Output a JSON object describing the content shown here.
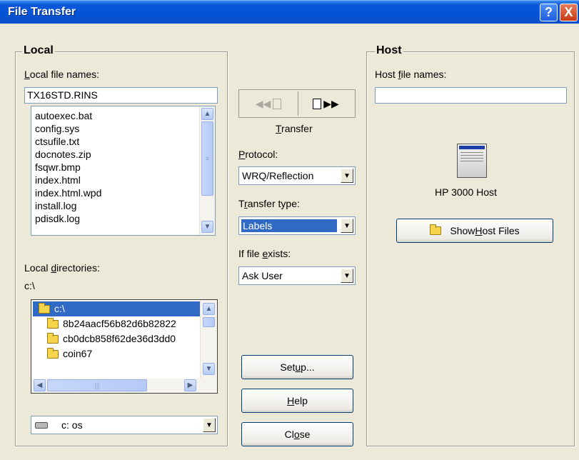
{
  "window": {
    "title": "File Transfer",
    "help_glyph": "?",
    "close_glyph": "X"
  },
  "local": {
    "group_label": "Local",
    "file_names_label_u": "L",
    "file_names_label_rest": "ocal file names:",
    "file_name_value": "TX16STD.RINS",
    "files": [
      "autoexec.bat",
      "config.sys",
      "ctsufile.txt",
      "docnotes.zip",
      "fsqwr.bmp",
      "index.html",
      "index.html.wpd",
      "install.log",
      "pdisdk.log"
    ],
    "dirs_label_pre": "Local ",
    "dirs_label_u": "d",
    "dirs_label_rest": "irectories:",
    "current_dir": "c:\\",
    "dirs": [
      "c:\\",
      "8b24aacf56b82d6b82822",
      "cb0dcb858f62de36d3dd0",
      "coin67"
    ],
    "drive_value": "c:  os"
  },
  "middle": {
    "transfer_label_u": "T",
    "transfer_label_rest": "ransfer",
    "protocol_label_u": "P",
    "protocol_label_rest": "rotocol:",
    "protocol_value": "WRQ/Reflection",
    "transfer_type_label_pre": "T",
    "transfer_type_label_u": "r",
    "transfer_type_label_rest": "ansfer type:",
    "transfer_type_value": "Labels",
    "if_exists_label_pre": "If file ",
    "if_exists_label_u": "e",
    "if_exists_label_rest": "xists:",
    "if_exists_value": "Ask User",
    "setup_pre": "Set",
    "setup_u": "u",
    "setup_rest": "p...",
    "help_u": "H",
    "help_rest": "elp",
    "close_pre": "Cl",
    "close_u": "o",
    "close_rest": "se"
  },
  "host": {
    "group_label": "Host",
    "file_names_label_pre": "Host ",
    "file_names_label_u": "f",
    "file_names_label_rest": "ile names:",
    "file_name_value": "",
    "host_name": "HP 3000 Host",
    "show_files_pre": "Show ",
    "show_files_u": "H",
    "show_files_rest": "ost Files"
  }
}
